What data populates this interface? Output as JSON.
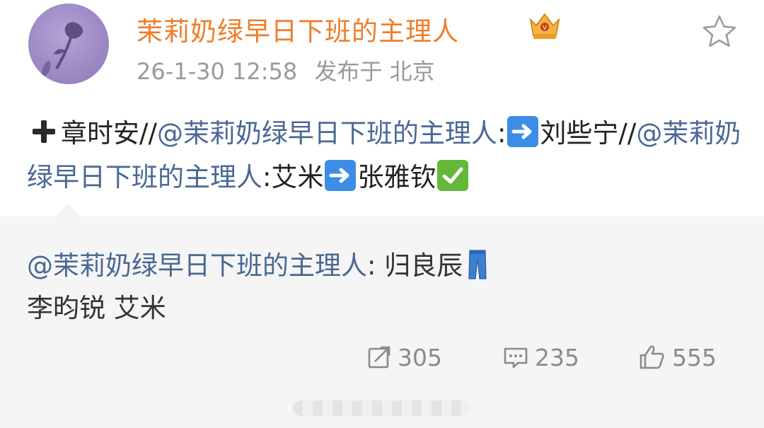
{
  "post": {
    "username": "茉莉奶绿早日下班的主理人",
    "vip_icon": "vip-crown-icon",
    "favorite_icon": "star-outline-icon",
    "timestamp": "26-1-30 12:58",
    "source": "发布于 北京",
    "text": {
      "prefix_emoji": "heavy-plus-sign-emoji",
      "part1": "章时安//",
      "mention1": "@茉莉奶绿早日下班的主理人",
      "part2": ":",
      "arrow1": "right-arrow-emoji",
      "part3": "刘些宁//",
      "mention2": "@茉莉奶绿早日下班的主理人",
      "part4": ":艾米",
      "arrow2": "right-arrow-emoji",
      "part5": "张雅钦",
      "check": "check-mark-button-emoji"
    }
  },
  "quote": {
    "mention": "@茉莉奶绿早日下班的主理人",
    "text1": ": 归良辰",
    "jeans_emoji": "jeans-emoji",
    "text2": "李昀锐 艾米"
  },
  "actions": {
    "repost_icon": "repost-icon",
    "repost_count": "305",
    "comment_icon": "comment-icon",
    "comment_count": "235",
    "like_icon": "thumbs-up-icon",
    "like_count": "555"
  },
  "colors": {
    "username": "#ef7d2b",
    "mention": "#4a6894",
    "meta": "#9a9a9a",
    "quote_bg": "#f5f5f5",
    "action": "#8a8a8a"
  }
}
